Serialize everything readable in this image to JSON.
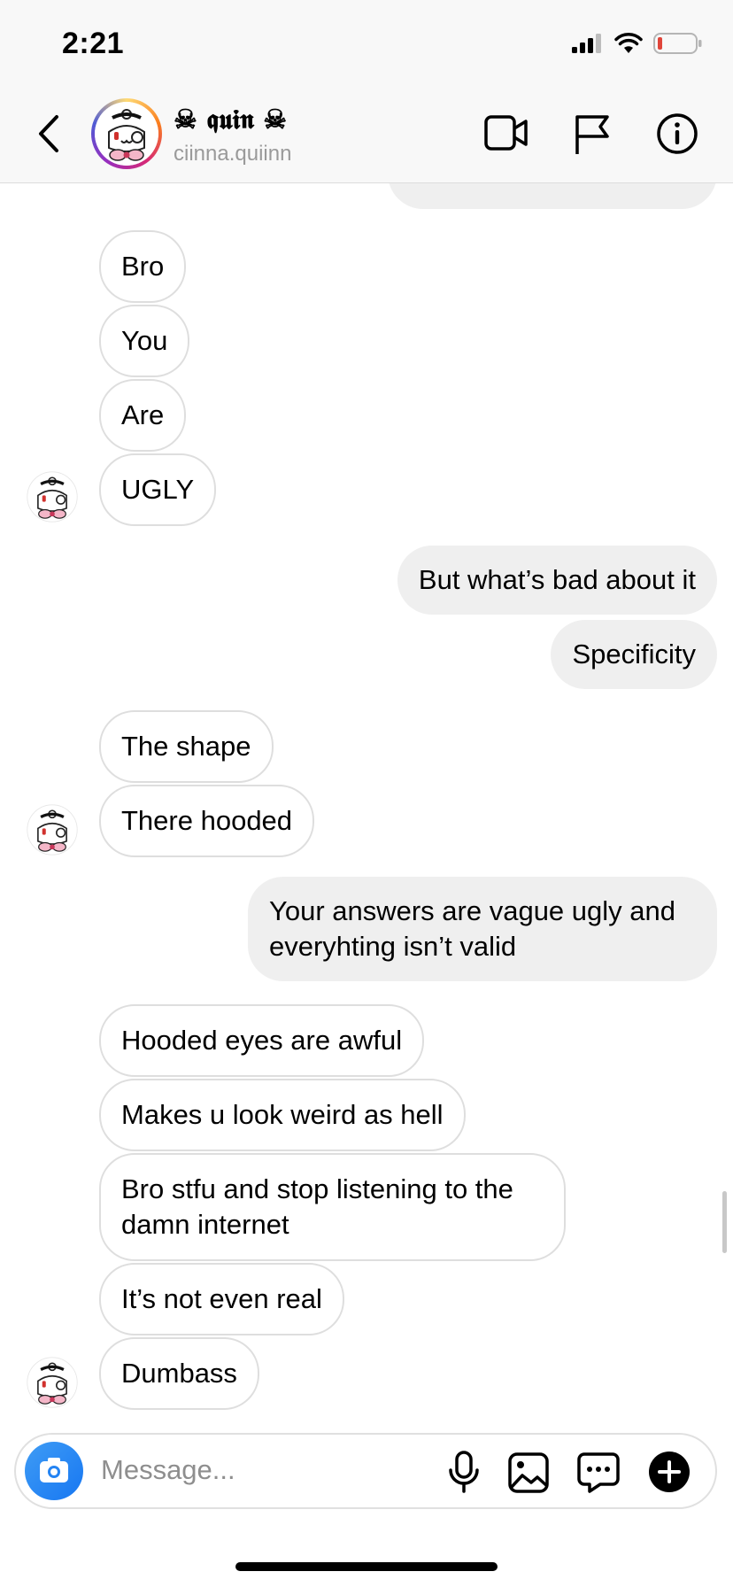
{
  "status_bar": {
    "time": "2:21"
  },
  "header": {
    "name": "☠ 𝖖𝖚𝖎𝖓 ☠",
    "username": "ciinna.quiinn"
  },
  "messages": [
    {
      "side": "in",
      "text": "Bro"
    },
    {
      "side": "in",
      "text": "You"
    },
    {
      "side": "in",
      "text": "Are"
    },
    {
      "side": "in",
      "text": "UGLY"
    },
    {
      "side": "out",
      "text": "But what’s bad about it"
    },
    {
      "side": "out",
      "text": "Specificity"
    },
    {
      "side": "in",
      "text": "The shape"
    },
    {
      "side": "in",
      "text": "There hooded"
    },
    {
      "side": "out",
      "line1": "Your answers are vague ugly and",
      "line2": "everyhting isn’t valid"
    },
    {
      "side": "in",
      "text": "Hooded eyes are awful"
    },
    {
      "side": "in",
      "text": "Makes u look weird as hell"
    },
    {
      "side": "in",
      "line1": "Bro stfu and stop listening to the",
      "line2": "damn internet"
    },
    {
      "side": "in",
      "text": "It’s not even real"
    },
    {
      "side": "in",
      "text": "Dumbass"
    }
  ],
  "composer": {
    "placeholder": "Message..."
  },
  "icons": {
    "back": "chevron-left-icon",
    "video": "video-call-icon",
    "report": "flag-icon",
    "info": "info-icon",
    "camera": "camera-icon",
    "mic": "microphone-icon",
    "gallery": "image-icon",
    "sticker": "chat-bubble-icon",
    "add": "plus-icon"
  },
  "colors": {
    "incoming_border": "#dedede",
    "outgoing_bg": "#efefef",
    "camera_button": "#1777f2",
    "battery_low": "#e0453a"
  }
}
